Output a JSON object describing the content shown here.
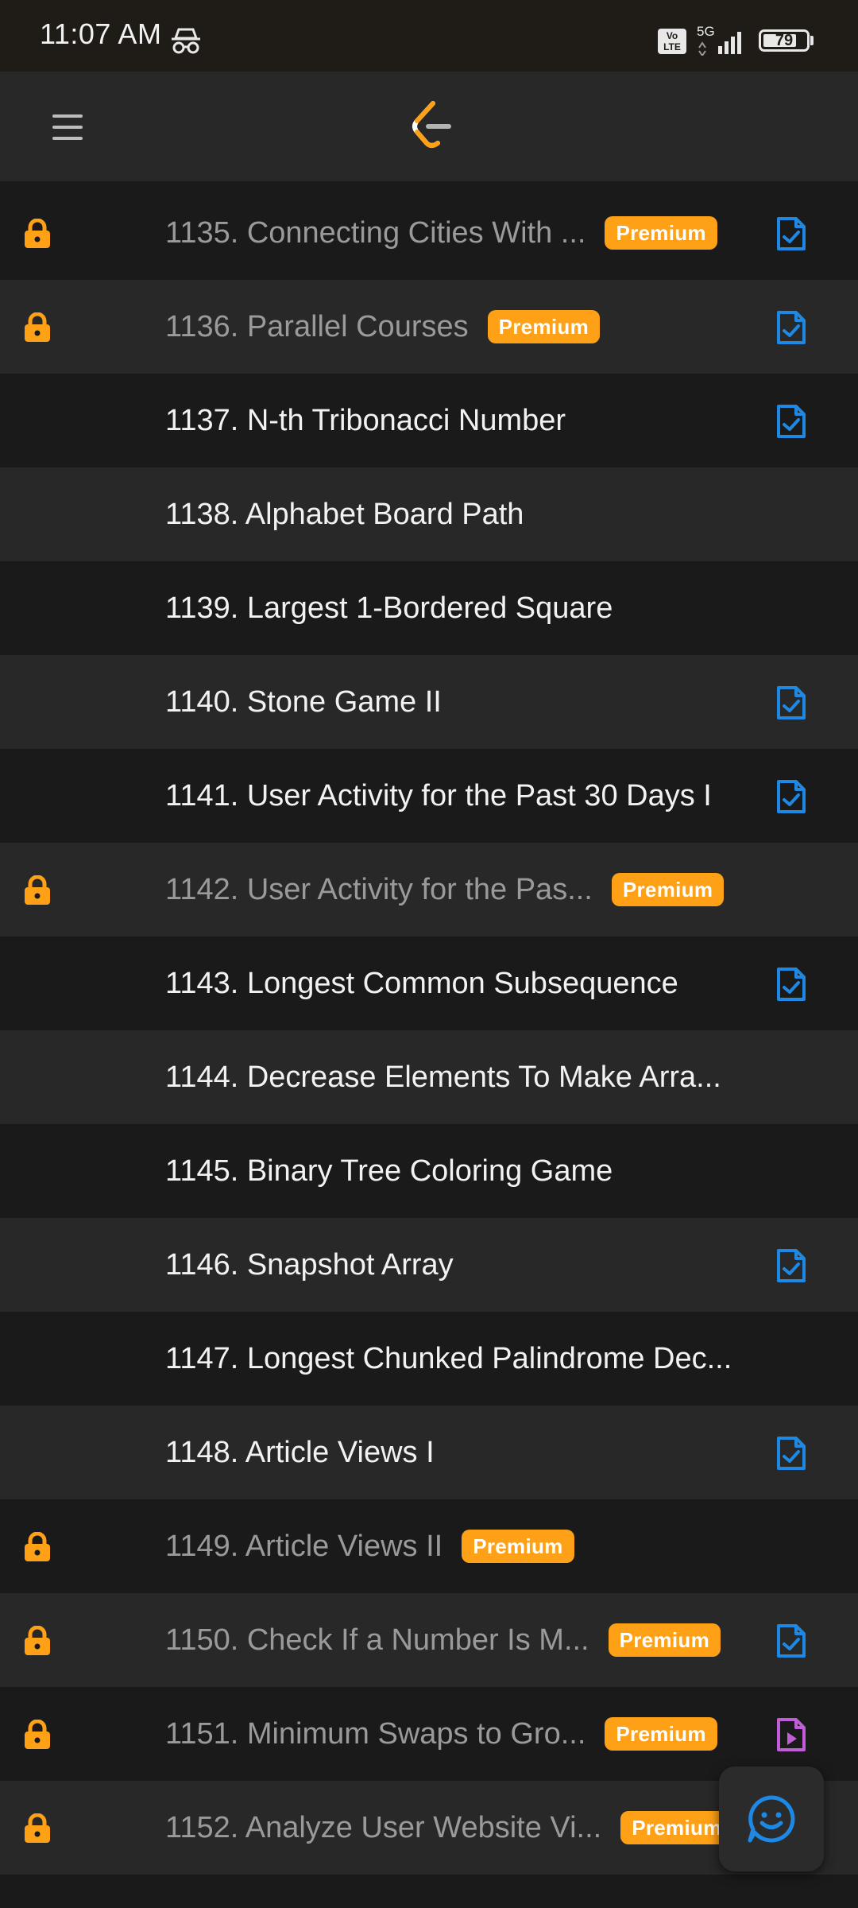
{
  "status_bar": {
    "time": "11:07 AM",
    "network": "5G",
    "volte_top": "Vo",
    "volte_bottom": "LTE",
    "battery": "79",
    "battery_level": 0.79
  },
  "header": {
    "menu_icon": "hamburger-menu-icon",
    "logo_icon": "leetcode-logo"
  },
  "colors": {
    "premium": "#ffa116",
    "lock": "#ffa116",
    "solution_doc": "#1e88e5",
    "video_doc": "#c05ed8"
  },
  "problems": [
    {
      "title": "1135. Connecting Cities With ...",
      "premium": "Premium",
      "locked": true,
      "icon": "doc-check"
    },
    {
      "title": "1136. Parallel Courses",
      "premium": "Premium",
      "locked": true,
      "icon": "doc-check"
    },
    {
      "title": "1137. N-th Tribonacci Number",
      "premium": "",
      "locked": false,
      "icon": "doc-check"
    },
    {
      "title": "1138. Alphabet Board Path",
      "premium": "",
      "locked": false,
      "icon": ""
    },
    {
      "title": "1139. Largest 1-Bordered Square",
      "premium": "",
      "locked": false,
      "icon": ""
    },
    {
      "title": "1140. Stone Game II",
      "premium": "",
      "locked": false,
      "icon": "doc-check"
    },
    {
      "title": "1141. User Activity for the Past 30 Days I",
      "premium": "",
      "locked": false,
      "icon": "doc-check"
    },
    {
      "title": "1142. User Activity for the Pas...",
      "premium": "Premium",
      "locked": true,
      "icon": ""
    },
    {
      "title": "1143. Longest Common Subsequence",
      "premium": "",
      "locked": false,
      "icon": "doc-check"
    },
    {
      "title": "1144. Decrease Elements To Make Arra...",
      "premium": "",
      "locked": false,
      "icon": ""
    },
    {
      "title": "1145. Binary Tree Coloring Game",
      "premium": "",
      "locked": false,
      "icon": ""
    },
    {
      "title": "1146. Snapshot Array",
      "premium": "",
      "locked": false,
      "icon": "doc-check"
    },
    {
      "title": "1147. Longest Chunked Palindrome Dec...",
      "premium": "",
      "locked": false,
      "icon": ""
    },
    {
      "title": "1148. Article Views I",
      "premium": "",
      "locked": false,
      "icon": "doc-check"
    },
    {
      "title": "1149. Article Views II",
      "premium": "Premium",
      "locked": true,
      "icon": ""
    },
    {
      "title": "1150. Check If a Number Is M...",
      "premium": "Premium",
      "locked": true,
      "icon": "doc-check"
    },
    {
      "title": "1151. Minimum Swaps to Gro...",
      "premium": "Premium",
      "locked": true,
      "icon": "doc-play"
    },
    {
      "title": "1152. Analyze User Website Vi...",
      "premium": "Premium",
      "locked": true,
      "icon": ""
    }
  ],
  "fab": {
    "icon": "feedback-smiley-icon"
  }
}
